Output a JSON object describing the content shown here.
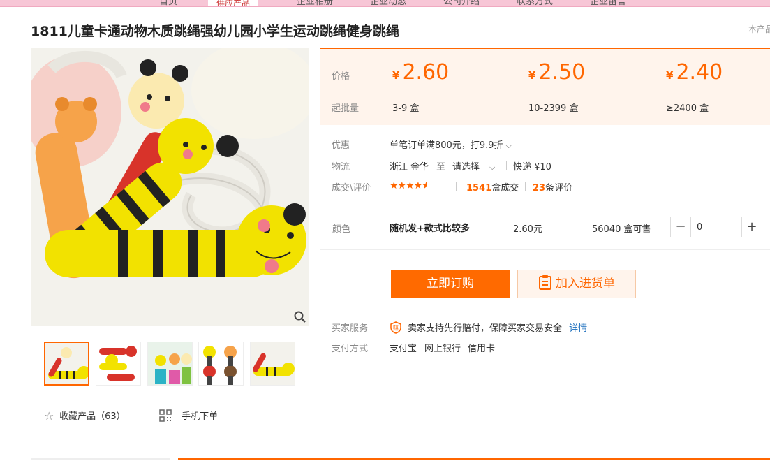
{
  "nav": {
    "items": [
      "首页",
      "供应产品",
      "企业相册",
      "企业动态",
      "公司介绍",
      "联系方式",
      "企业留言"
    ]
  },
  "title": "1811儿童卡通动物木质跳绳强幼儿园小学生运动跳绳健身跳绳",
  "report_link": "本产品",
  "gallery": {
    "zoom_icon": "magnifier-icon"
  },
  "actions": {
    "favorite_label": "收藏产品（63）",
    "mobile_label": "手机下单"
  },
  "price_box": {
    "price_label": "价格",
    "moq_label": "起批量",
    "currency": "¥",
    "tiers": [
      {
        "price": "2.60",
        "range": "3-9 盒"
      },
      {
        "price": "2.50",
        "range": "10-2399 盒"
      },
      {
        "price": "2.40",
        "range": "≥2400 盒"
      }
    ]
  },
  "info": {
    "discount_label": "优惠",
    "discount_value": "单笔订单满800元，打9.9折",
    "logistics_label": "物流",
    "origin": "浙江 金华",
    "to": "至",
    "select": "请选择",
    "express": "快递 ¥10",
    "deal_label": "成交\\评价",
    "rating": 4.5,
    "deals_count": "1541",
    "deals_unit": "盒成交",
    "reviews_count": "23",
    "reviews_unit": "条评价"
  },
  "sku": {
    "label": "颜色",
    "name": "随机发+款式比较多",
    "price": "2.60元",
    "stock": "56040 盒可售",
    "quantity": "0"
  },
  "buttons": {
    "buy": "立即订购",
    "cart": "加入进货单"
  },
  "service": {
    "buyer_label": "买家服务",
    "buyer_text": "卖家支持先行赔付，保障买家交易安全",
    "detail_link": "详情",
    "pay_label": "支付方式",
    "pay_methods": [
      "支付宝",
      "网上银行",
      "信用卡"
    ]
  },
  "colors": {
    "accent": "#ff6a00",
    "price_bg": "#fff4ec",
    "nav_pink": "#f7c6d6"
  }
}
